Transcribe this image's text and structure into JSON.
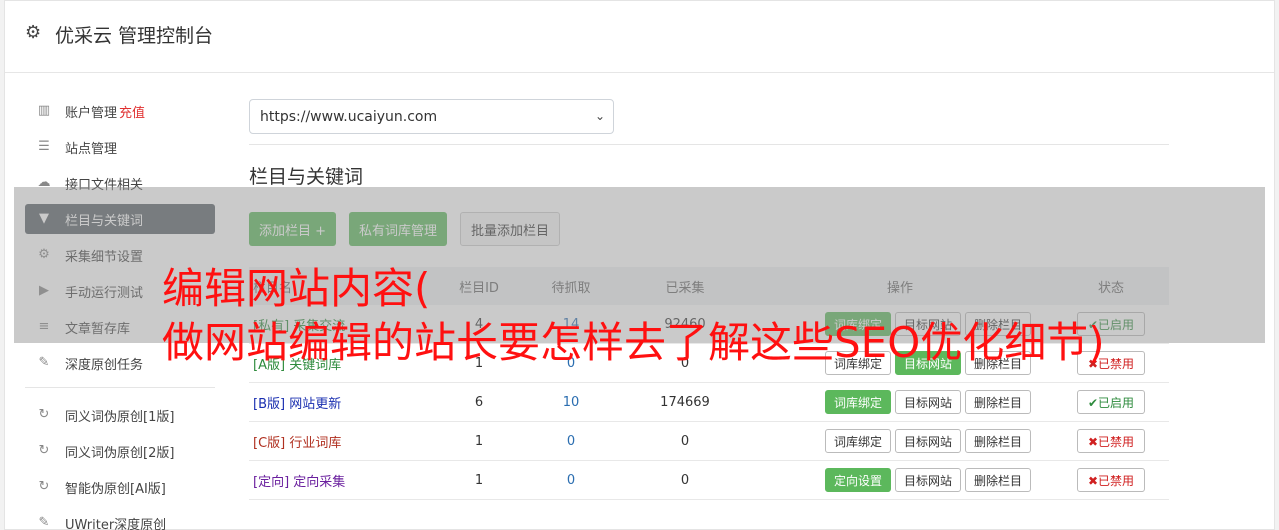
{
  "header": {
    "title": "优采云 管理控制台",
    "icon": "gear-icon"
  },
  "sidebar": {
    "items": [
      {
        "label": "账户管理",
        "accent": "充值",
        "icon": "bar-chart-icon"
      },
      {
        "label": "站点管理",
        "icon": "server-icon"
      },
      {
        "label": "接口文件相关",
        "icon": "cloud-upload-icon"
      },
      {
        "label": "栏目与关键词",
        "icon": "filter-icon",
        "active": true
      },
      {
        "label": "采集细节设置",
        "icon": "cogs-icon"
      },
      {
        "label": "手动运行测试",
        "icon": "play-icon"
      },
      {
        "label": "文章暂存库",
        "icon": "database-icon"
      },
      {
        "label": "深度原创任务",
        "icon": "edit-icon"
      },
      {
        "label": "同义词伪原创[1版]",
        "icon": "refresh-icon"
      },
      {
        "label": "同义词伪原创[2版]",
        "icon": "refresh-icon"
      },
      {
        "label": "智能伪原创[AI版]",
        "icon": "refresh-icon"
      },
      {
        "label": "UWriter深度原创",
        "icon": "edit-icon"
      }
    ]
  },
  "main": {
    "site_select": "https://www.ucaiyun.com",
    "section_title": "栏目与关键词",
    "buttons": {
      "add_column": "添加栏目 +",
      "private_lib": "私有词库管理",
      "batch_add": "批量添加栏目"
    },
    "table": {
      "headers": {
        "name": "栏目名",
        "id": "栏目ID",
        "wait": "待抓取",
        "done": "已采集",
        "op": "操作",
        "status": "状态"
      },
      "rows": [
        {
          "tag": "[私有]",
          "name": "采集交流",
          "id": "4",
          "wait": "14",
          "done": "92460",
          "op1": "词库绑定",
          "op2": "目标网站",
          "op3": "删除栏目",
          "status": "✔已启用"
        },
        {
          "tag": "[A版]",
          "name": "关键词库",
          "id": "1",
          "wait": "0",
          "done": "0",
          "op1": "词库绑定",
          "op2": "目标网站",
          "op3": "删除栏目",
          "status": "✖已禁用"
        },
        {
          "tag": "[B版]",
          "name": "网站更新",
          "id": "6",
          "wait": "10",
          "done": "174669",
          "op1": "词库绑定",
          "op2": "目标网站",
          "op3": "删除栏目",
          "status": "✔已启用"
        },
        {
          "tag": "[C版]",
          "name": "行业词库",
          "id": "1",
          "wait": "0",
          "done": "0",
          "op1": "词库绑定",
          "op2": "目标网站",
          "op3": "删除栏目",
          "status": "✖已禁用"
        },
        {
          "tag": "[定向]",
          "name": "定向采集",
          "id": "1",
          "wait": "0",
          "done": "0",
          "op1": "定向设置",
          "op2": "目标网站",
          "op3": "删除栏目",
          "status": "✖已禁用"
        }
      ]
    }
  },
  "overlay": {
    "line1": "编辑网站内容(",
    "line2": "做网站编辑的站长要怎样去了解这些SEO优化细节)"
  }
}
